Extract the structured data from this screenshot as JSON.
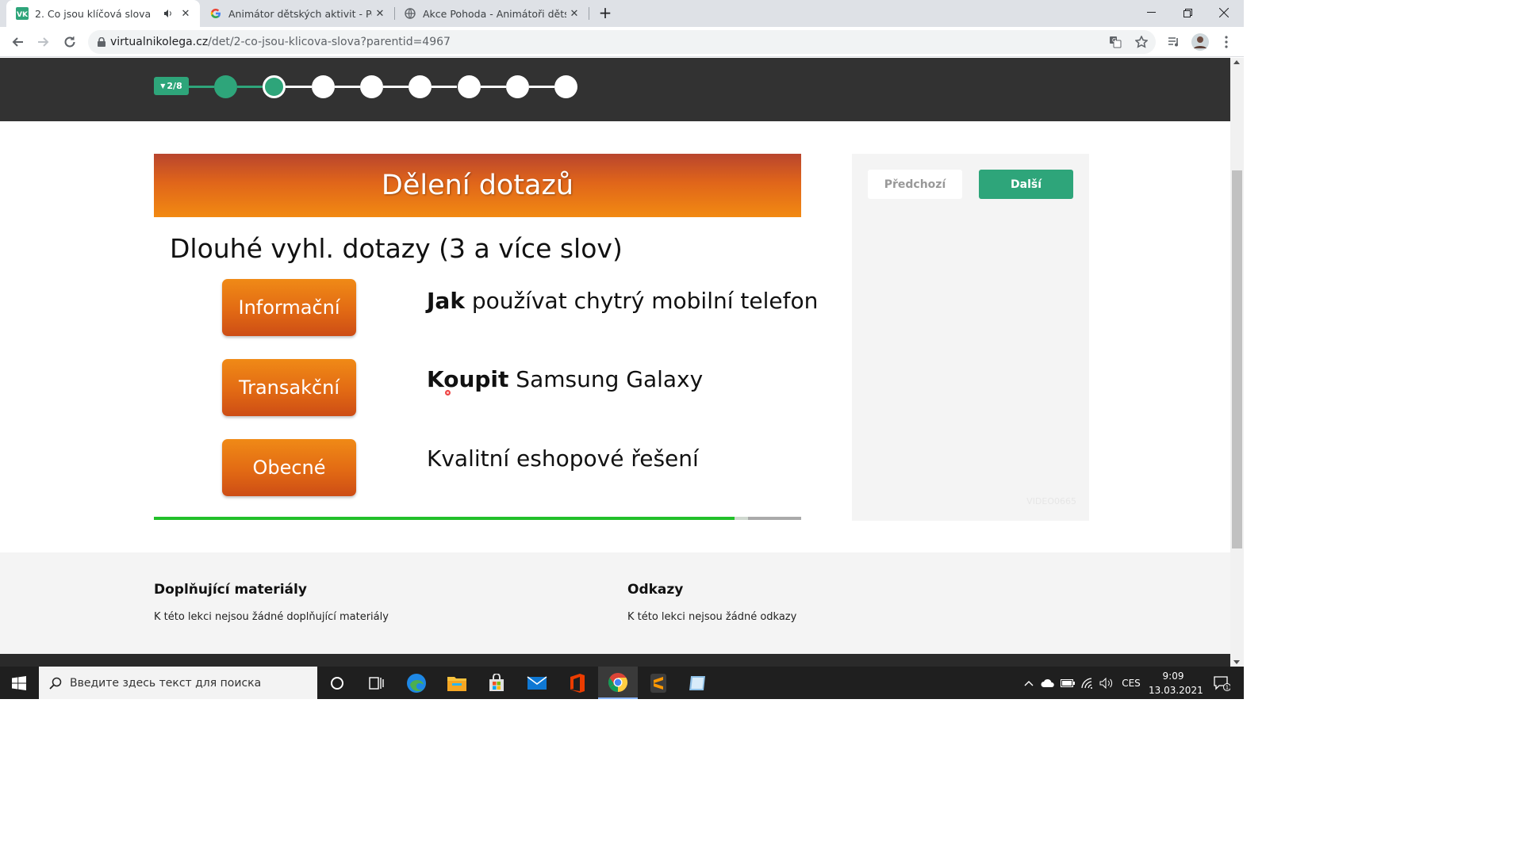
{
  "browser": {
    "tabs": [
      {
        "title": "2. Co jsou klíčová slova",
        "favicon": "vk-icon",
        "active": true,
        "muted_icon": "speaker-icon"
      },
      {
        "title": "Animátor dětských aktivit - Pouz",
        "favicon": "google-icon",
        "active": false
      },
      {
        "title": "Akce Pohoda - Animátoři dětský",
        "favicon": "globe-icon",
        "active": false
      }
    ],
    "url_host": "virtualnikolega.cz",
    "url_path": "/det/2-co-jsou-klicova-slova?parentid=4967",
    "favicon_vk_text": "VK"
  },
  "progress": {
    "badge": "2/8",
    "steps_total": 8,
    "steps_completed": 1,
    "current_step": 2
  },
  "slide": {
    "title": "Dělení dotazů",
    "subtitle": "Dlouhé vyhl. dotazy (3 a více slov)",
    "rows": [
      {
        "category": "Informační",
        "example_bold": "Jak",
        "example_rest": " používat chytrý mobilní telefon"
      },
      {
        "category": "Transakční",
        "example_bold": "Koupit",
        "example_rest": " Samsung Galaxy"
      },
      {
        "category": "Obecné",
        "example_bold": "",
        "example_rest": "Kvalitní eshopové řešení"
      }
    ],
    "video_progress": 0.897,
    "video_buffered": 0.918
  },
  "side_panel": {
    "prev_label": "Předchozí",
    "next_label": "Další",
    "video_id": "VIDEO0665"
  },
  "materials": {
    "title": "Doplňující materiály",
    "text": "K této lekci nejsou žádné doplňující materiály"
  },
  "links": {
    "title": "Odkazy",
    "text": "K této lekci nejsou žádné odkazy"
  },
  "taskbar": {
    "search_placeholder": "Введите здесь текст для поиска",
    "language": "CES",
    "time": "9:09",
    "date": "13.03.2021",
    "notification_count": "1"
  },
  "colors": {
    "accent_green": "#2ea57a",
    "header_orange": "#f28a12",
    "dark_band": "#323232"
  }
}
